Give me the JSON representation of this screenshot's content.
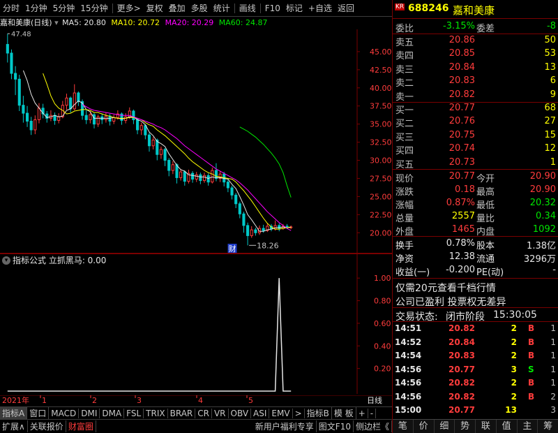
{
  "toolbar": {
    "items": [
      "分时",
      "1分钟",
      "5分钟",
      "15分钟",
      "更多>",
      "复权",
      "叠加",
      "多股",
      "统计",
      "画线",
      "F10",
      "标记",
      "+自选",
      "返回"
    ]
  },
  "header": {
    "stock_name": "嘉和美康",
    "period": "(日线)",
    "ma5_label": "MA5: 20.80",
    "ma10_label": "MA10: 20.72",
    "ma20_label": "MA20: 20.29",
    "ma60_label": "MA60: 24.87",
    "ma5_color": "#e6e6e6",
    "ma10_color": "#ffff00",
    "ma20_color": "#ff00ff",
    "ma60_color": "#00e600"
  },
  "indicator": {
    "title": "指标公式  立抓黑马: 0.00"
  },
  "chart_data": [
    {
      "type": "candlestick",
      "name": "price",
      "y_ticks": [
        "45.00",
        "42.50",
        "40.00",
        "37.50",
        "35.00",
        "32.50",
        "30.00",
        "27.50",
        "25.00",
        "22.50",
        "20.00"
      ],
      "ylim": [
        18.0,
        47.5
      ],
      "high_label": "47.48",
      "low_label": "18.26",
      "event_label": "财",
      "up_color": "#ff3c3c",
      "down_color": "#00c8c8",
      "candles": [
        [
          46.0,
          44.8,
          47.48,
          43.5
        ],
        [
          44.8,
          42.0,
          45.3,
          41.2
        ],
        [
          42.0,
          41.2,
          43.0,
          39.0
        ],
        [
          41.2,
          37.6,
          41.8,
          36.8
        ],
        [
          37.6,
          36.5,
          38.9,
          35.2
        ],
        [
          36.5,
          35.4,
          37.5,
          34.6
        ],
        [
          35.4,
          34.2,
          36.0,
          33.5
        ],
        [
          34.2,
          35.6,
          36.2,
          33.6
        ],
        [
          35.6,
          37.2,
          37.9,
          35.1
        ],
        [
          37.2,
          36.4,
          37.8,
          35.8
        ],
        [
          36.4,
          35.8,
          36.8,
          35.2
        ],
        [
          35.8,
          36.2,
          36.9,
          35.4
        ],
        [
          36.2,
          35.5,
          36.6,
          34.9
        ],
        [
          35.5,
          36.0,
          36.5,
          35.1
        ],
        [
          36.0,
          37.6,
          38.2,
          35.8
        ],
        [
          37.6,
          38.6,
          39.2,
          37.0
        ],
        [
          38.6,
          37.1,
          38.8,
          36.6
        ],
        [
          37.1,
          39.3,
          40.5,
          36.9
        ],
        [
          39.3,
          38.1,
          39.5,
          37.5
        ],
        [
          38.1,
          36.2,
          38.4,
          35.6
        ],
        [
          36.2,
          35.6,
          36.9,
          35.0
        ],
        [
          35.6,
          36.3,
          36.8,
          35.1
        ],
        [
          36.3,
          35.0,
          36.5,
          34.4
        ],
        [
          35.0,
          36.0,
          36.3,
          34.6
        ],
        [
          36.0,
          35.6,
          36.4,
          35.0
        ],
        [
          35.6,
          36.1,
          36.6,
          35.2
        ],
        [
          36.1,
          35.4,
          36.4,
          34.8
        ],
        [
          35.4,
          35.9,
          36.3,
          35.0
        ],
        [
          35.9,
          36.4,
          36.9,
          35.6
        ],
        [
          36.4,
          35.5,
          36.6,
          34.9
        ],
        [
          35.5,
          36.0,
          36.5,
          35.1
        ],
        [
          36.0,
          36.8,
          37.3,
          35.7
        ],
        [
          36.8,
          35.6,
          37.0,
          35.0
        ],
        [
          35.6,
          34.2,
          35.8,
          33.6
        ],
        [
          34.2,
          34.8,
          35.2,
          33.5
        ],
        [
          34.8,
          33.5,
          35.0,
          32.9
        ],
        [
          33.5,
          32.0,
          33.8,
          31.2
        ],
        [
          32.0,
          32.8,
          33.2,
          31.5
        ],
        [
          32.8,
          30.8,
          33.0,
          30.0
        ],
        [
          30.8,
          31.5,
          31.9,
          30.2
        ],
        [
          31.5,
          30.0,
          31.7,
          29.2
        ],
        [
          30.0,
          28.6,
          30.3,
          27.8
        ],
        [
          28.6,
          29.4,
          29.9,
          28.1
        ],
        [
          29.4,
          27.6,
          29.6,
          26.8
        ],
        [
          27.6,
          28.4,
          28.8,
          27.2
        ],
        [
          28.4,
          27.1,
          28.6,
          26.5
        ],
        [
          27.1,
          28.2,
          28.7,
          26.8
        ],
        [
          28.2,
          27.4,
          28.5,
          26.9
        ],
        [
          27.4,
          28.0,
          28.4,
          27.0
        ],
        [
          28.0,
          27.2,
          28.3,
          26.7
        ],
        [
          27.2,
          27.9,
          28.3,
          26.9
        ],
        [
          27.9,
          27.0,
          28.2,
          26.5
        ],
        [
          27.0,
          28.6,
          29.0,
          26.8
        ],
        [
          28.6,
          27.5,
          29.6,
          27.1
        ],
        [
          27.5,
          28.1,
          28.5,
          27.0
        ],
        [
          28.1,
          27.0,
          28.4,
          26.4
        ],
        [
          27.0,
          26.2,
          27.3,
          25.6
        ],
        [
          26.2,
          25.2,
          26.5,
          24.6
        ],
        [
          25.2,
          24.0,
          25.5,
          23.4
        ],
        [
          24.0,
          22.6,
          24.3,
          22.0
        ],
        [
          22.6,
          21.0,
          22.9,
          20.0
        ],
        [
          21.0,
          19.6,
          21.4,
          18.26
        ],
        [
          19.6,
          20.4,
          20.9,
          19.3
        ],
        [
          20.4,
          20.0,
          20.7,
          19.6
        ],
        [
          20.0,
          20.6,
          21.0,
          19.7
        ],
        [
          20.6,
          20.3,
          21.1,
          20.0
        ],
        [
          20.3,
          20.9,
          21.3,
          20.1
        ],
        [
          20.9,
          20.5,
          21.2,
          20.2
        ],
        [
          20.5,
          21.0,
          21.7,
          20.3
        ],
        [
          21.0,
          20.6,
          21.3,
          20.2
        ],
        [
          20.6,
          20.9,
          21.2,
          20.4
        ],
        [
          20.9,
          20.7,
          21.2,
          20.5
        ],
        [
          20.7,
          20.8,
          21.0,
          20.5
        ]
      ],
      "ma5": [
        null,
        null,
        null,
        null,
        42.4,
        41.0,
        39.1,
        37.9,
        37.2,
        36.5,
        35.9,
        36.0,
        36.2,
        36.0,
        36.1,
        36.9,
        37.1,
        37.7,
        38.2,
        37.9,
        37.0,
        36.7,
        35.8,
        35.8,
        35.8,
        35.8,
        35.8,
        35.9,
        35.8,
        35.7,
        35.8,
        36.0,
        36.0,
        35.6,
        35.4,
        34.9,
        33.9,
        33.4,
        32.6,
        32.3,
        31.9,
        30.9,
        30.1,
        29.3,
        28.7,
        28.5,
        28.0,
        27.9,
        27.8,
        27.7,
        27.7,
        27.5,
        27.7,
        27.6,
        27.6,
        27.5,
        27.4,
        26.7,
        26.1,
        25.0,
        23.8,
        22.5,
        21.8,
        21.0,
        20.2,
        20.2,
        20.4,
        20.5,
        20.7,
        20.7,
        20.8,
        20.7,
        20.8
      ],
      "ma10": [
        null,
        null,
        null,
        null,
        null,
        null,
        null,
        null,
        null,
        42.0,
        40.5,
        38.9,
        37.8,
        37.2,
        36.9,
        36.4,
        36.5,
        36.8,
        36.9,
        37.0,
        37.0,
        36.9,
        36.6,
        36.6,
        36.4,
        36.2,
        36.1,
        35.9,
        35.8,
        35.8,
        35.8,
        35.9,
        35.9,
        35.8,
        35.6,
        35.2,
        34.9,
        34.7,
        34.2,
        33.8,
        33.4,
        32.9,
        32.4,
        31.9,
        31.4,
        30.9,
        30.3,
        29.8,
        29.4,
        29.0,
        28.6,
        28.3,
        28.1,
        27.8,
        27.7,
        27.6,
        27.5,
        27.4,
        27.0,
        26.4,
        25.8,
        25.1,
        24.4,
        23.6,
        22.8,
        22.0,
        21.3,
        20.8,
        20.5,
        20.5,
        20.6,
        20.7,
        20.72
      ],
      "ma20": [
        null,
        null,
        null,
        null,
        null,
        null,
        null,
        null,
        null,
        null,
        null,
        null,
        null,
        null,
        null,
        null,
        null,
        null,
        null,
        37.7,
        37.4,
        37.1,
        36.9,
        36.8,
        36.7,
        36.6,
        36.5,
        36.4,
        36.3,
        36.2,
        36.2,
        36.2,
        36.0,
        35.8,
        35.6,
        35.4,
        35.2,
        35.0,
        34.7,
        34.5,
        34.2,
        33.8,
        33.4,
        33.0,
        32.5,
        32.0,
        31.6,
        31.2,
        30.8,
        30.4,
        30.0,
        29.6,
        29.2,
        28.8,
        28.5,
        28.2,
        27.9,
        27.6,
        27.3,
        26.9,
        26.4,
        25.9,
        25.3,
        24.7,
        24.1,
        23.5,
        22.9,
        22.4,
        21.9,
        21.4,
        21.0,
        20.6,
        20.29
      ],
      "ma60": [
        null,
        null,
        null,
        null,
        null,
        null,
        null,
        null,
        null,
        null,
        null,
        null,
        null,
        null,
        null,
        null,
        null,
        null,
        null,
        null,
        null,
        null,
        null,
        null,
        null,
        null,
        null,
        null,
        null,
        null,
        null,
        null,
        null,
        null,
        null,
        null,
        null,
        null,
        null,
        null,
        null,
        null,
        null,
        null,
        null,
        null,
        null,
        null,
        null,
        null,
        null,
        null,
        null,
        null,
        null,
        null,
        null,
        null,
        null,
        34.6,
        34.3,
        34.0,
        33.6,
        33.2,
        32.7,
        32.2,
        31.6,
        31.0,
        30.3,
        29.5,
        28.3,
        26.5,
        24.87
      ]
    },
    {
      "type": "line",
      "name": "立抓黑马",
      "y_ticks": [
        "1.00",
        "0.80",
        "0.60",
        "0.40",
        "0.20"
      ],
      "ylim": [
        0,
        1.1
      ],
      "values": [
        0,
        0,
        0,
        0,
        0,
        0,
        0,
        0,
        0,
        0,
        0,
        0,
        0,
        0,
        0,
        0,
        0,
        0,
        0,
        0,
        0,
        0,
        0,
        0,
        0,
        0,
        0,
        0,
        0,
        0,
        0,
        0,
        0,
        0,
        0,
        0,
        0,
        0,
        0,
        0,
        0,
        0,
        0,
        0,
        0,
        0,
        0,
        0,
        0,
        0,
        0,
        0,
        0,
        0,
        0,
        0,
        0,
        0,
        0,
        0,
        0,
        0,
        0,
        0,
        0,
        0,
        0,
        0,
        0,
        1,
        0,
        0,
        0
      ],
      "line_color": "#e6e6e6"
    }
  ],
  "date_axis": {
    "year_label": "2021年",
    "month_labels": [
      "1",
      "2",
      "3",
      "4",
      "5"
    ],
    "right_label": "日线"
  },
  "tabs_row1": [
    "指标A",
    "窗口",
    "MACD",
    "DMI",
    "DMA",
    "FSL",
    "TRIX",
    "BRAR",
    "CR",
    "VR",
    "OBV",
    "ASI",
    "EMV",
    ">",
    "指标B",
    "模 板",
    "+",
    "-"
  ],
  "tabs_row2": [
    "扩展∧",
    "关联报价",
    "财富圈",
    "新用户福利专享",
    "图文F10",
    "侧边栏《"
  ],
  "quote": {
    "badge": "KR",
    "code": "688246",
    "name": "嘉和美康",
    "weibi_label": "委比",
    "weibi_value": "-3.15%",
    "weicha_label": "委差",
    "weicha_value": "-8",
    "asks": [
      {
        "label": "卖五",
        "price": "20.86",
        "vol": "50"
      },
      {
        "label": "卖四",
        "price": "20.85",
        "vol": "53"
      },
      {
        "label": "卖三",
        "price": "20.84",
        "vol": "13"
      },
      {
        "label": "卖二",
        "price": "20.83",
        "vol": "6"
      },
      {
        "label": "卖一",
        "price": "20.82",
        "vol": "9"
      }
    ],
    "bids": [
      {
        "label": "买一",
        "price": "20.77",
        "vol": "68"
      },
      {
        "label": "买二",
        "price": "20.76",
        "vol": "27"
      },
      {
        "label": "买三",
        "price": "20.75",
        "vol": "15"
      },
      {
        "label": "买四",
        "price": "20.74",
        "vol": "12"
      },
      {
        "label": "买五",
        "price": "20.73",
        "vol": "1"
      }
    ],
    "stats": [
      {
        "l1": "现价",
        "v1": "20.77",
        "c1": "red",
        "l2": "今开",
        "v2": "20.90",
        "c2": "red"
      },
      {
        "l1": "涨跌",
        "v1": "0.18",
        "c1": "red",
        "l2": "最高",
        "v2": "20.90",
        "c2": "red"
      },
      {
        "l1": "涨幅",
        "v1": "0.87%",
        "c1": "red",
        "l2": "最低",
        "v2": "20.32",
        "c2": "green"
      },
      {
        "l1": "总量",
        "v1": "2557",
        "c1": "yellow",
        "l2": "量比",
        "v2": "0.34",
        "c2": "green"
      },
      {
        "l1": "外盘",
        "v1": "1465",
        "c1": "red",
        "l2": "内盘",
        "v2": "1092",
        "c2": "green"
      }
    ],
    "stats2": [
      {
        "l1": "换手",
        "v1": "0.78%",
        "l2": "股本",
        "v2": "1.38亿"
      },
      {
        "l1": "净资",
        "v1": "12.38",
        "l2": "流通",
        "v2": "3296万"
      },
      {
        "l1": "收益(一)",
        "v1": "-0.200",
        "l2": "PE(动)",
        "v2": "-"
      }
    ],
    "promo1": "仅需20元查看千档行情",
    "promo2": "公司已盈利 投票权无差异",
    "status_label": "交易状态:",
    "status_value": "闭市阶段",
    "status_time": "15:30:05",
    "ticks": [
      {
        "time": "14:51",
        "price": "20.82",
        "vol": "2",
        "side": "B",
        "n": "1"
      },
      {
        "time": "14:52",
        "price": "20.84",
        "vol": "2",
        "side": "B",
        "n": "1"
      },
      {
        "time": "14:54",
        "price": "20.83",
        "vol": "2",
        "side": "B",
        "n": "1"
      },
      {
        "time": "14:56",
        "price": "20.77",
        "vol": "3",
        "side": "S",
        "n": "1"
      },
      {
        "time": "14:56",
        "price": "20.82",
        "vol": "2",
        "side": "B",
        "n": "1"
      },
      {
        "time": "14:56",
        "price": "20.82",
        "vol": "2",
        "side": "B",
        "n": "2"
      },
      {
        "time": "15:00",
        "price": "20.77",
        "vol": "13",
        "side": "",
        "n": "3"
      }
    ],
    "bottom_icons": [
      "笔",
      "价",
      "细",
      "势",
      "联",
      "值",
      "主",
      "筹"
    ]
  }
}
